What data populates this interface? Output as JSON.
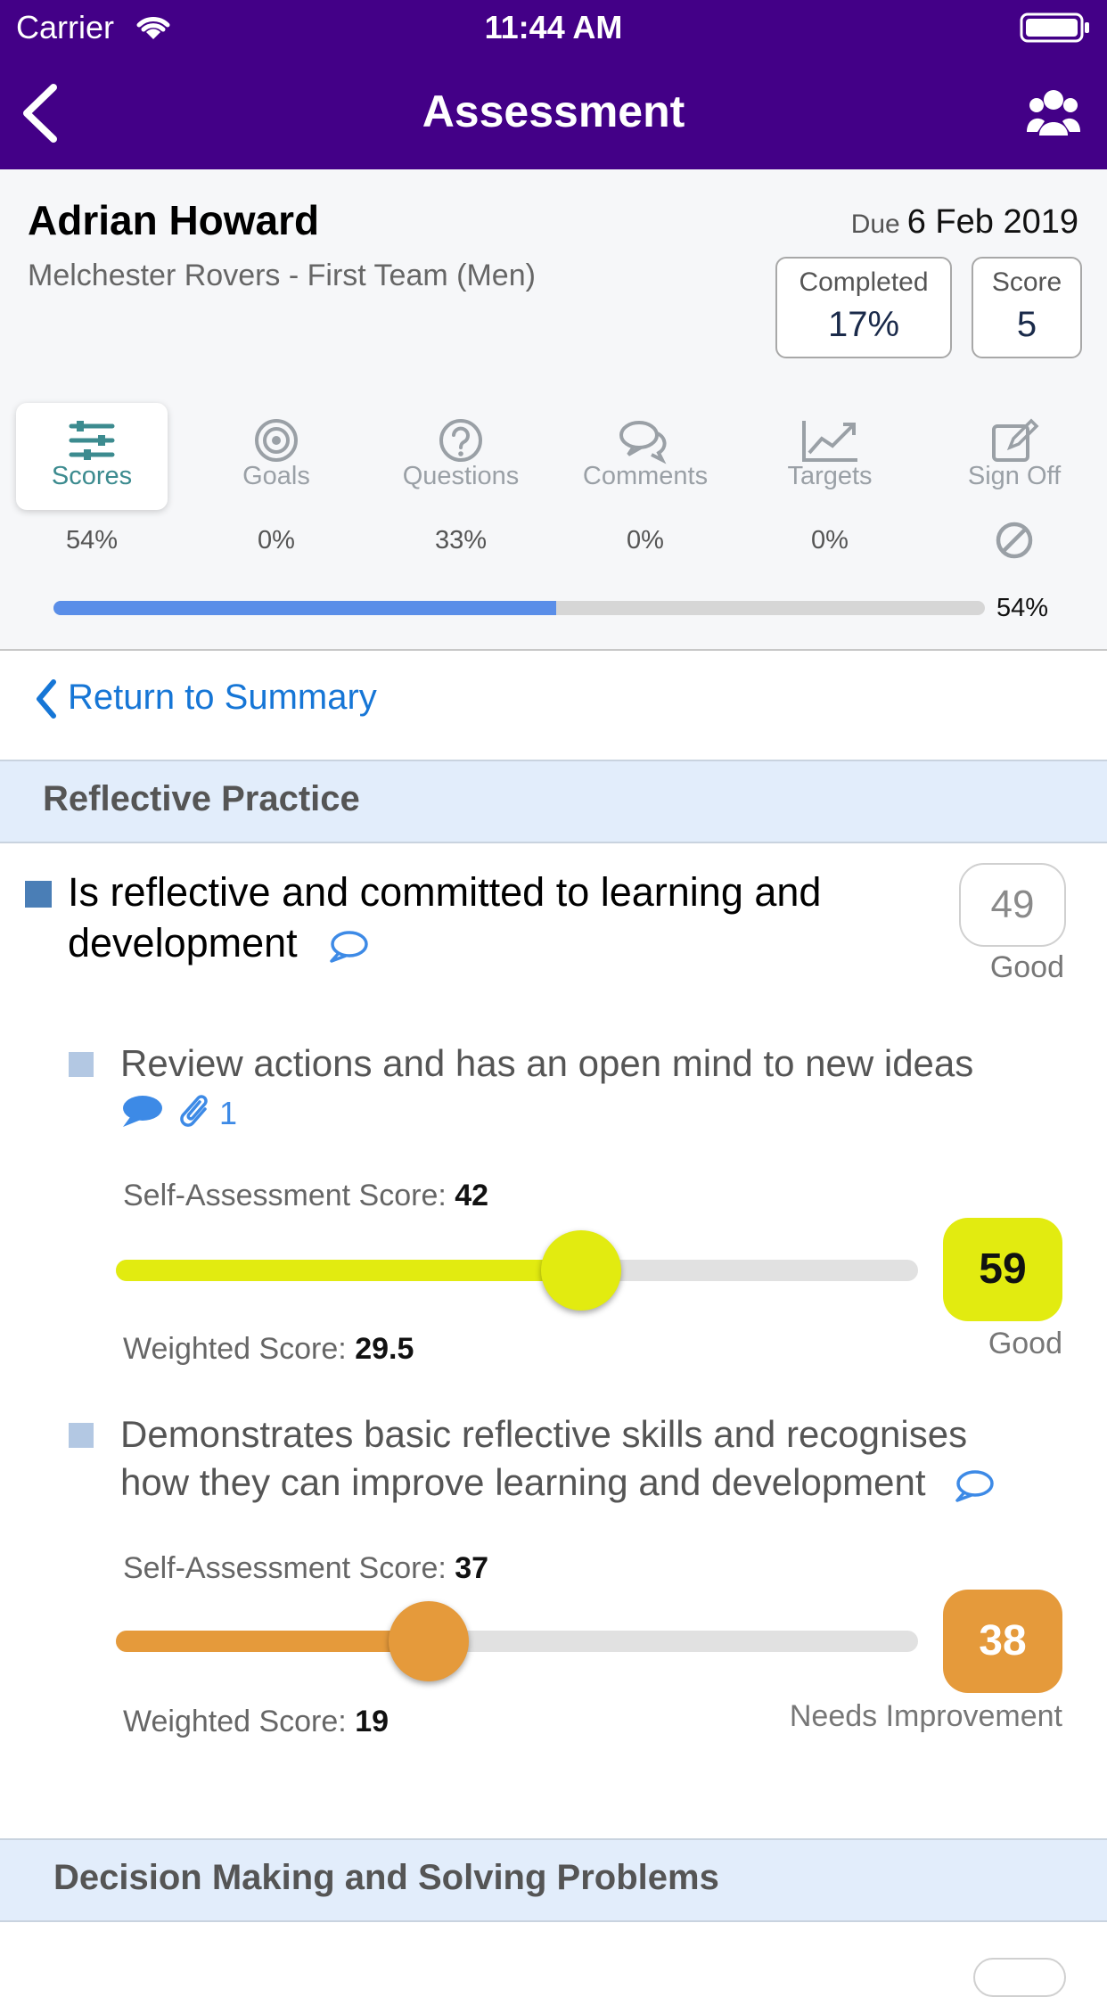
{
  "status": {
    "carrier": "Carrier",
    "time": "11:44 AM"
  },
  "nav": {
    "title": "Assessment",
    "back_icon": "chevron-left-icon",
    "team_icon": "users-icon"
  },
  "athlete": {
    "name": "Adrian Howard",
    "team": "Melchester Rovers - First Team (Men)"
  },
  "due": {
    "label": "Due",
    "date": "6 Feb 2019"
  },
  "completed": {
    "label": "Completed",
    "value": "17%"
  },
  "score": {
    "label": "Score",
    "value": "5"
  },
  "tabs": [
    {
      "label": "Scores",
      "pct": "54%",
      "icon": "sliders-icon",
      "active": true
    },
    {
      "label": "Goals",
      "pct": "0%",
      "icon": "target-icon",
      "active": false
    },
    {
      "label": "Questions",
      "pct": "33%",
      "icon": "question-icon",
      "active": false
    },
    {
      "label": "Comments",
      "pct": "0%",
      "icon": "comments-icon",
      "active": false
    },
    {
      "label": "Targets",
      "pct": "0%",
      "icon": "chart-icon",
      "active": false
    },
    {
      "label": "Sign Off",
      "pct": "",
      "icon": "edit-icon",
      "active": false
    }
  ],
  "progress": {
    "value": 0.54,
    "label": "54%"
  },
  "return_link": "Return to Summary",
  "section1": {
    "title": "Reflective Practice"
  },
  "criterion": {
    "line1": "Is reflective and committed to learning and",
    "line2": "development",
    "score": "49",
    "grade": "Good"
  },
  "sub1": {
    "text": "Review actions and has an open mind to new ideas",
    "attachments": "1",
    "self_label": "Self-Assessment Score:",
    "self_value": "42",
    "weighted_label": "Weighted Score:",
    "weighted_value": "29.5",
    "slider": 0.58,
    "score": "59",
    "grade": "Good",
    "color": "#e2eb10"
  },
  "sub2": {
    "line1": "Demonstrates basic reflective skills and recognises",
    "line2": "how they can improve learning and development",
    "self_label": "Self-Assessment Score:",
    "self_value": "37",
    "weighted_label": "Weighted Score:",
    "weighted_value": "19",
    "slider": 0.39,
    "score": "38",
    "grade": "Needs Improvement",
    "color": "#e59a3b"
  },
  "section2": {
    "title": "Decision Making and Solving Problems"
  }
}
